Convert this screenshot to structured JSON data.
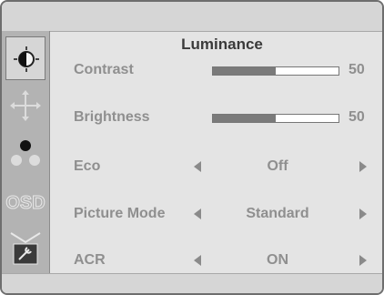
{
  "osd": {
    "section_title": "Luminance",
    "sidebar": [
      {
        "icon": "luminance-icon",
        "active": true
      },
      {
        "icon": "image-position-icon",
        "active": false
      },
      {
        "icon": "color-icon",
        "active": false
      },
      {
        "icon": "osd-icon",
        "active": false
      },
      {
        "icon": "extra-tools-icon",
        "active": false
      }
    ],
    "settings": {
      "contrast": {
        "label": "Contrast",
        "value": "50",
        "level": 0.5
      },
      "brightness": {
        "label": "Brightness",
        "value": "50",
        "level": 0.5
      },
      "eco": {
        "label": "Eco",
        "value": "Off"
      },
      "picture_mode": {
        "label": "Picture Mode",
        "value": "Standard"
      },
      "acr": {
        "label": "ACR",
        "value": "ON"
      }
    },
    "sidebar_osd_text": "OSD"
  }
}
